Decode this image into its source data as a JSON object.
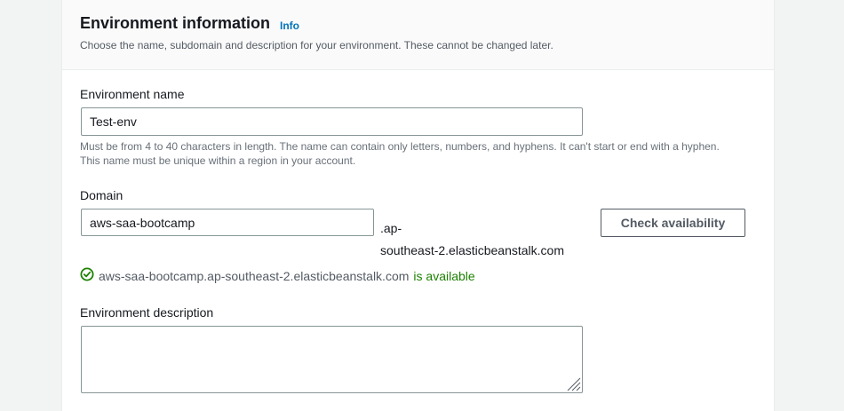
{
  "section": {
    "title": "Environment information",
    "info_link": "Info",
    "description": "Choose the name, subdomain and description for your environment. These cannot be changed later."
  },
  "env_name": {
    "label": "Environment name",
    "value": "Test-env",
    "hint_line1": "Must be from 4 to 40 characters in length. The name can contain only letters, numbers, and hyphens. It can't start or end with a hyphen.",
    "hint_line2": "This name must be unique within a region in your account."
  },
  "domain": {
    "label": "Domain",
    "value": "aws-saa-bootcamp",
    "suffix_line1": ".ap-",
    "suffix_line2": "southeast-2.elasticbeanstalk.com",
    "check_button": "Check availability",
    "status_domain": "aws-saa-bootcamp.ap-southeast-2.elasticbeanstalk.com",
    "status_text": "is available",
    "status_icon": "check-circle-icon",
    "status_color": "#1d8102"
  },
  "env_description": {
    "label": "Environment description",
    "value": ""
  },
  "colors": {
    "link": "#0073bb",
    "border": "#879596",
    "header_bg": "#fafafa"
  }
}
